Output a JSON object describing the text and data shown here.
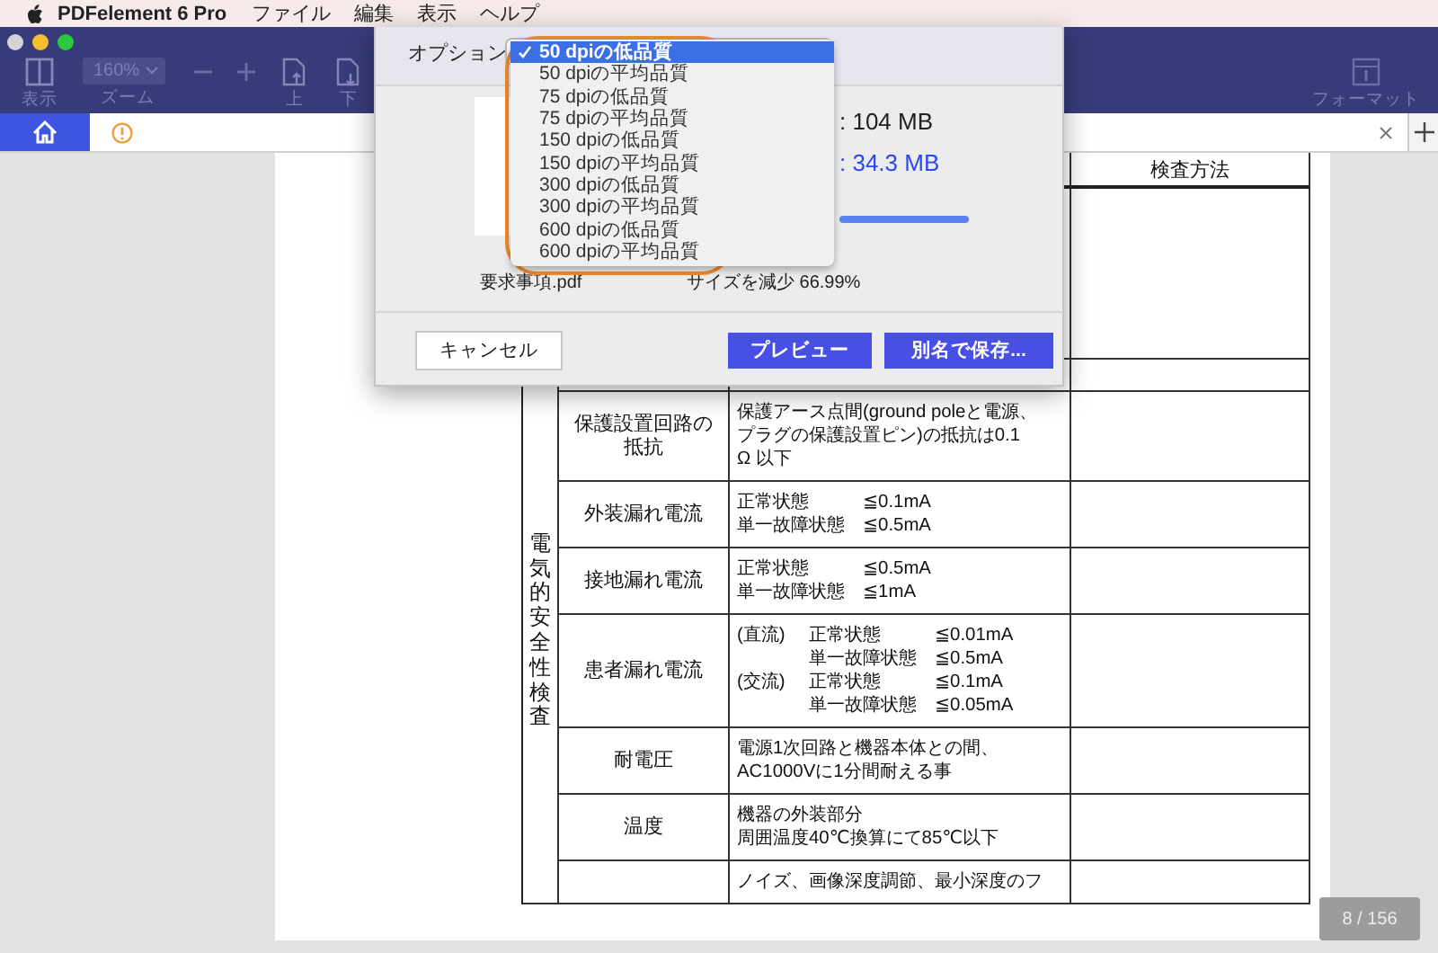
{
  "menu_bar": {
    "app_name": "PDFelement 6 Pro",
    "items": [
      "ファイル",
      "編集",
      "表示",
      "ヘルプ"
    ]
  },
  "toolbar": {
    "tools": [
      {
        "kind": "panel",
        "label": "表示"
      },
      {
        "kind": "zoom",
        "value": "160%",
        "label": "ズーム"
      },
      {
        "kind": "minus"
      },
      {
        "kind": "plus"
      },
      {
        "kind": "page_up",
        "label": "上"
      },
      {
        "kind": "page_down",
        "label": "下"
      },
      {
        "kind": "format",
        "label": "フォーマット"
      }
    ]
  },
  "document": {
    "table": {
      "header": "検査方法",
      "group_label": "電気的安全性検査",
      "rows": [
        {
          "item": "保護設置回路の抵抗",
          "kind": "text",
          "lines": [
            "保護アース点間(ground poleと電源、",
            "プラグの保護設置ピン)の抵抗は0.1",
            "Ω 以下"
          ]
        },
        {
          "item": "外装漏れ電流",
          "kind": "limits",
          "limits": [
            {
              "state": "正常状態",
              "limit": "≦0.1mA"
            },
            {
              "state": "単一故障状態",
              "limit": "≦0.5mA"
            }
          ]
        },
        {
          "item": "接地漏れ電流",
          "kind": "limits",
          "limits": [
            {
              "state": "正常状態",
              "limit": "≦0.5mA"
            },
            {
              "state": "単一故障状態",
              "limit": "≦1mA"
            }
          ]
        },
        {
          "item": "患者漏れ電流",
          "kind": "limits",
          "limits": [
            {
              "prefix": "(直流)",
              "state": "正常状態",
              "limit": "≦0.01mA"
            },
            {
              "state": "単一故障状態",
              "limit": "≦0.5mA"
            },
            {
              "prefix": "(交流)",
              "state": "正常状態",
              "limit": "≦0.1mA"
            },
            {
              "state": "単一故障状態",
              "limit": "≦0.05mA"
            }
          ]
        },
        {
          "item": "耐電圧",
          "kind": "text",
          "lines": [
            "電源1次回路と機器本体との間、",
            "AC1000Vに1分間耐える事"
          ]
        },
        {
          "item": "温度",
          "kind": "text",
          "lines": [
            "機器の外装部分",
            "周囲温度40℃換算にて85℃以下"
          ]
        },
        {
          "kind": "text",
          "lines": [
            "ノイズ、画像深度調節、最小深度のフ"
          ]
        }
      ]
    },
    "page_counter": "8 / 156"
  },
  "dialog": {
    "option_label": "オプション",
    "options": [
      {
        "label": "50 dpiの低品質",
        "selected": true
      },
      {
        "label": "50 dpiの平均品質",
        "selected": false
      },
      {
        "label": "75 dpiの低品質",
        "selected": false
      },
      {
        "label": "75 dpiの平均品質",
        "selected": false
      },
      {
        "label": "150 dpiの低品質",
        "selected": false
      },
      {
        "label": "150 dpiの平均品質",
        "selected": false
      },
      {
        "label": "300 dpiの低品質",
        "selected": false
      },
      {
        "label": "300 dpiの平均品質",
        "selected": false
      },
      {
        "label": "600 dpiの低品質",
        "selected": false
      },
      {
        "label": "600 dpiの平均品質",
        "selected": false
      }
    ],
    "original_size": ": 104 MB",
    "compressed_size": ": 34.3 MB",
    "file_name": "要求事項.pdf",
    "reduction": "サイズを減少 66.99%",
    "buttons": [
      {
        "label": "キャンセル",
        "kind": "secondary"
      },
      {
        "label": "プレビュー",
        "kind": "primary"
      },
      {
        "label": "別名で保存...",
        "kind": "primary"
      }
    ]
  }
}
